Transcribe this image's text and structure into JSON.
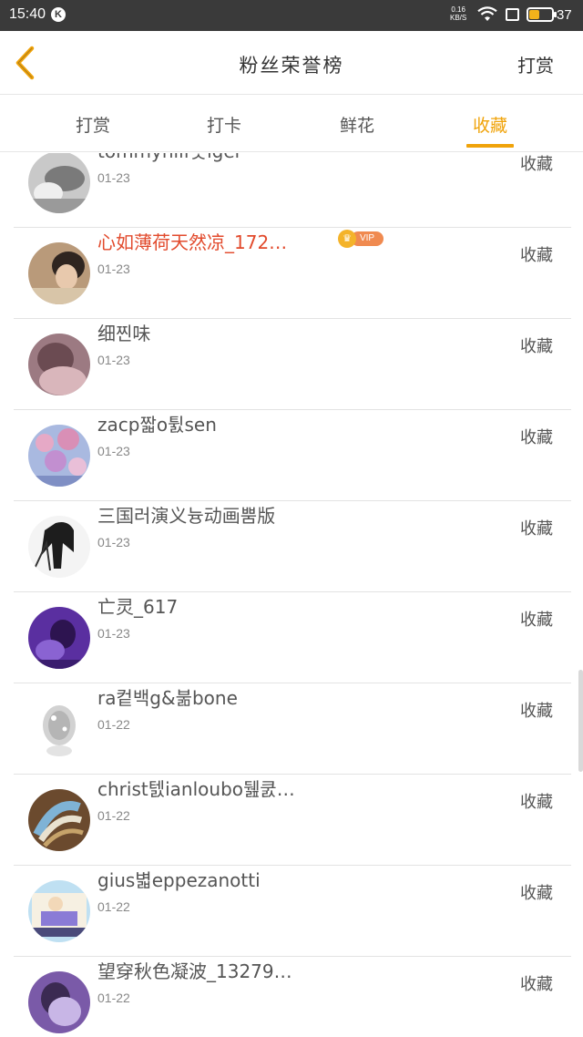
{
  "status_bar": {
    "time": "15:40",
    "notification_glyph": "K",
    "net_speed_value": "0.16",
    "net_speed_unit": "KB/S",
    "battery_level": "37",
    "battery_fill_fraction": 0.45,
    "battery_color": "#f2b21b"
  },
  "header": {
    "title": "粉丝荣誉榜",
    "action_label": "打赏",
    "back_icon": "chevron-left-icon",
    "back_icon_color": "#f0a30a"
  },
  "tabs": [
    {
      "label": "打赏",
      "active": false
    },
    {
      "label": "打卡",
      "active": false
    },
    {
      "label": "鲜花",
      "active": false
    },
    {
      "label": "收藏",
      "active": true
    }
  ],
  "accent_color": "#f0a30a",
  "vip_badge": {
    "label": "VIP"
  },
  "fans": [
    {
      "name": "tommyhilf웃iger",
      "date": "01-23",
      "action": "收藏",
      "vip": false
    },
    {
      "name": "心如薄荷天然凉_172…",
      "date": "01-23",
      "action": "收藏",
      "vip": true
    },
    {
      "name": "细찐味",
      "date": "01-23",
      "action": "收藏",
      "vip": false
    },
    {
      "name": "zacp짧o튌sen",
      "date": "01-23",
      "action": "收藏",
      "vip": false
    },
    {
      "name": "三国러演义늉动画뿜版",
      "date": "01-23",
      "action": "收藏",
      "vip": false
    },
    {
      "name": "亡灵_617",
      "date": "01-23",
      "action": "收藏",
      "vip": false
    },
    {
      "name": "ra컽백g&붊bone",
      "date": "01-22",
      "action": "收藏",
      "vip": false
    },
    {
      "name": "christ텘ianloubo뒖쿬…",
      "date": "01-22",
      "action": "收藏",
      "vip": false
    },
    {
      "name": "gius볇eppezanotti",
      "date": "01-22",
      "action": "收藏",
      "vip": false
    },
    {
      "name": "望穿秋色凝波_13279…",
      "date": "01-22",
      "action": "收藏",
      "vip": false
    }
  ]
}
